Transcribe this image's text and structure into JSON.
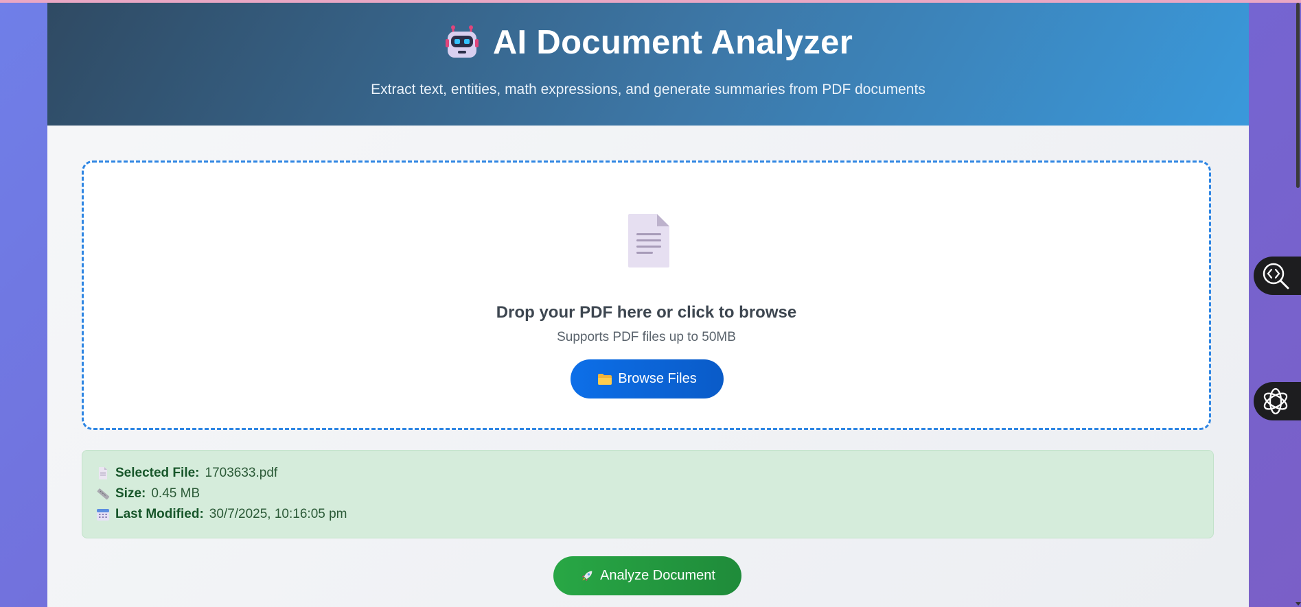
{
  "header": {
    "title": "AI Document Analyzer",
    "subtitle": "Extract text, entities, math expressions, and generate summaries from PDF documents",
    "icon": "robot-icon"
  },
  "dropzone": {
    "icon": "document-icon",
    "title": "Drop your PDF here or click to browse",
    "subtitle": "Supports PDF files up to 50MB",
    "browse_label": "Browse Files",
    "browse_icon": "folder-icon"
  },
  "file_info": {
    "name_label": "Selected File:",
    "name_value": "1703633.pdf",
    "size_label": "Size:",
    "size_value": "0.45 MB",
    "modified_label": "Last Modified:",
    "modified_value": "30/7/2025, 10:16:05 pm"
  },
  "actions": {
    "analyze_label": "Analyze Document",
    "analyze_icon": "rocket-icon"
  },
  "side_widgets": [
    "code-inspect-icon",
    "openai-icon"
  ],
  "colors": {
    "accent_blue": "#0d6fe8",
    "accent_green": "#28a745",
    "info_bg": "#d5ecdb",
    "dropzone_border": "#2f86e3"
  }
}
